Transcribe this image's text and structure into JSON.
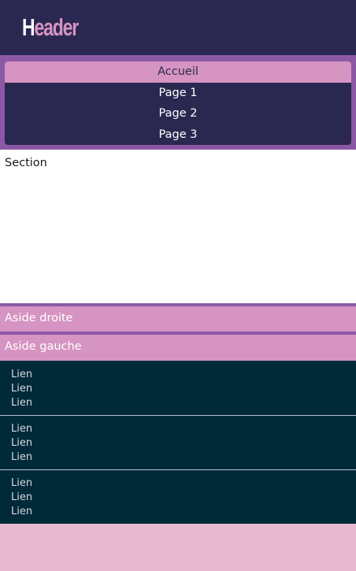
{
  "header": {
    "title_first_letter": "H",
    "title_rest": "eader"
  },
  "nav": {
    "items": [
      {
        "label": "Accueil",
        "active": true
      },
      {
        "label": "Page 1",
        "active": false
      },
      {
        "label": "Page 2",
        "active": false
      },
      {
        "label": "Page 3",
        "active": false
      }
    ]
  },
  "section": {
    "label": "Section"
  },
  "asides": {
    "right_label": "Aside droite",
    "left_label": "Aside gauche"
  },
  "footer": {
    "groups": [
      {
        "links": [
          "Lien",
          "Lien",
          "Lien"
        ]
      },
      {
        "links": [
          "Lien",
          "Lien",
          "Lien"
        ]
      },
      {
        "links": [
          "Lien",
          "Lien",
          "Lien"
        ]
      }
    ]
  },
  "colors": {
    "dark_navy": "#2a2850",
    "purple": "#8c58a6",
    "pink": "#d594c1",
    "light_pink": "#e6b9cf",
    "footer_teal": "#012a39"
  }
}
